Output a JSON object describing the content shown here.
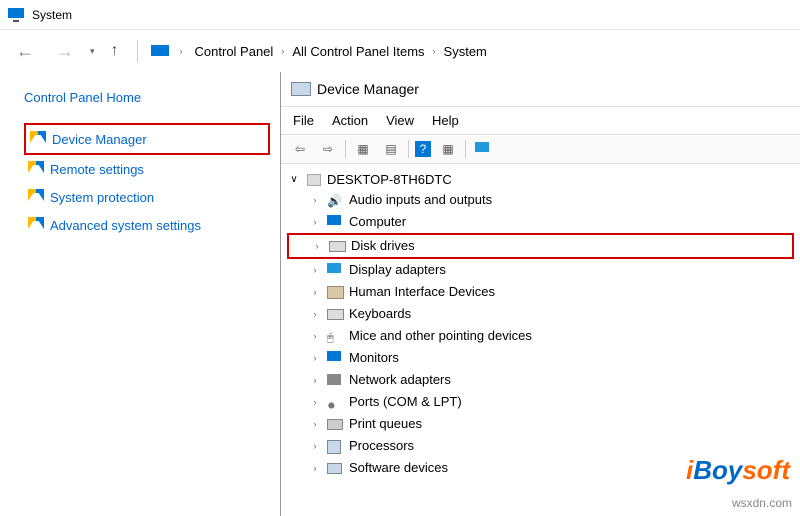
{
  "titlebar": {
    "title": "System"
  },
  "breadcrumb": {
    "c1": "Control Panel",
    "c2": "All Control Panel Items",
    "c3": "System"
  },
  "sidebar": {
    "home": "Control Panel Home",
    "task1": "Device Manager",
    "task2": "Remote settings",
    "task3": "System protection",
    "task4": "Advanced system settings"
  },
  "devmgr": {
    "title": "Device Manager",
    "menu": {
      "file": "File",
      "action": "Action",
      "view": "View",
      "help": "Help"
    },
    "root": "DESKTOP-8TH6DTC",
    "items": [
      "Audio inputs and outputs",
      "Computer",
      "Disk drives",
      "Display adapters",
      "Human Interface Devices",
      "Keyboards",
      "Mice and other pointing devices",
      "Monitors",
      "Network adapters",
      "Ports (COM & LPT)",
      "Print queues",
      "Processors",
      "Software devices"
    ]
  },
  "watermark": {
    "brand_i": "i",
    "brand_boy": "Boy",
    "brand_soft": "soft",
    "site": "wsxdn.com"
  }
}
